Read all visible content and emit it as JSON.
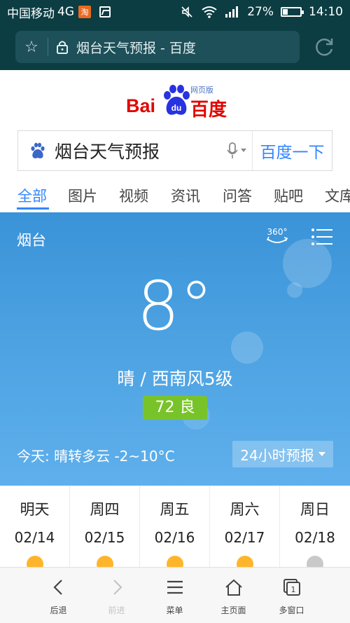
{
  "status_bar": {
    "carrier": "中国移动",
    "network": "4G",
    "taobao_badge": "淘",
    "battery": "27%",
    "battery_level": 0.27,
    "time": "14:10"
  },
  "browser": {
    "url_title": "烟台天气预报 - 百度"
  },
  "baidu": {
    "logo_bai": "Bai",
    "logo_du": "du",
    "logo_cn": "百度",
    "logo_tag": "网页版",
    "query": "烟台天气预报",
    "search_button": "百度一下",
    "tabs": [
      "全部",
      "图片",
      "视频",
      "资讯",
      "问答",
      "贴吧",
      "文库"
    ],
    "active_tab": 0
  },
  "weather": {
    "city": "烟台",
    "btn_360": "360°",
    "temperature": "8°",
    "condition": "晴 / 西南风5级",
    "aqi": "72 良",
    "aqi_color": "#79c32a",
    "today": "今天:  晴转多云  -2~10°C",
    "forecast_button": "24小时预报",
    "days": [
      {
        "name": "明天",
        "date": "02/14"
      },
      {
        "name": "周四",
        "date": "02/15"
      },
      {
        "name": "周五",
        "date": "02/16"
      },
      {
        "name": "周六",
        "date": "02/17"
      },
      {
        "name": "周日",
        "date": "02/18"
      }
    ]
  },
  "bottom_nav": {
    "back": "后退",
    "forward": "前进",
    "menu": "菜单",
    "home": "主页面",
    "windows": "多窗口",
    "window_count": "1"
  },
  "colors": {
    "accent": "#3385ff",
    "baidu_red": "#e10602",
    "status_bg": "#0b3d43"
  }
}
